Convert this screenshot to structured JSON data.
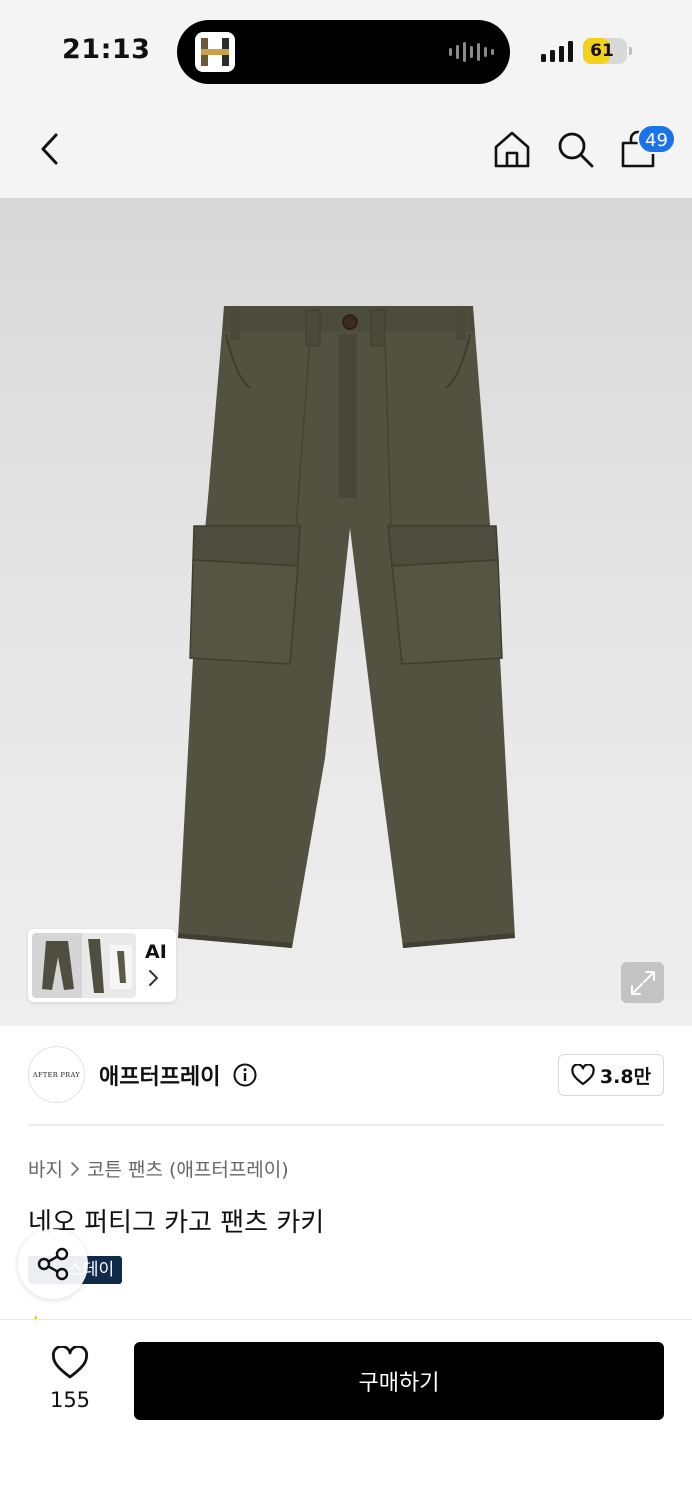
{
  "status_bar": {
    "time": "21:13",
    "battery": "61",
    "battery_level": 0.61,
    "battery_color": "#f5d21a"
  },
  "header": {
    "back_icon": "chevron-left-icon",
    "home_icon": "home-icon",
    "search_icon": "search-icon",
    "cart_icon": "shopping-bag-icon",
    "cart_count": "49",
    "badge_color": "#1a73e8"
  },
  "gallery": {
    "thumbnail_label": "AI",
    "expand_icon": "expand-icon",
    "product_color": "#4e4e3e"
  },
  "brand": {
    "logo_text": "AFTER PRAY",
    "name": "애프터프레이",
    "info_icon": "info-icon",
    "likes": "3.8만"
  },
  "breadcrumb": {
    "items": [
      "바지",
      "코튼 팬츠 (애프터프레이)"
    ]
  },
  "product": {
    "title": "네오 퍼티그 카고 팬츠 카키",
    "tag": "스데이"
  },
  "bottom_bar": {
    "wish_count": "155",
    "buy_label": "구매하기"
  }
}
